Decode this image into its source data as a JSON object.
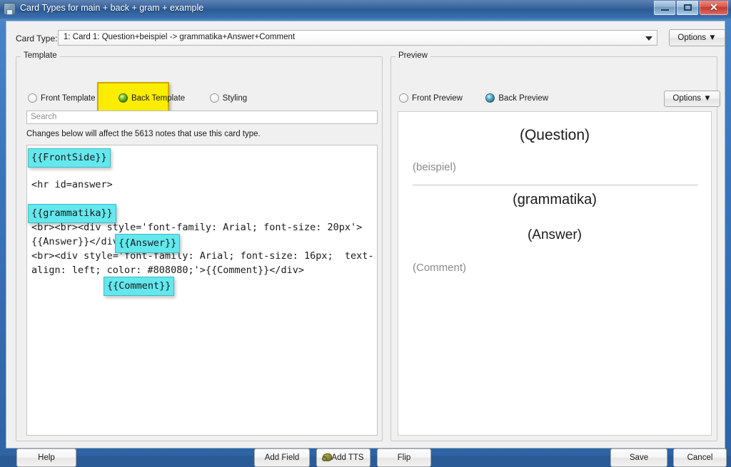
{
  "window": {
    "title": "Card Types for main + back + gram + example",
    "icon": "card-types-icon",
    "controls": {
      "minimize": "minimize-icon",
      "maximize": "maximize-icon",
      "close": "close-icon"
    }
  },
  "cardtype": {
    "label": "Card Type:",
    "value": "1: Card 1: Question+beispiel -> grammatika+Answer+Comment",
    "options_label": "Options ▼"
  },
  "template": {
    "legend": "Template",
    "radios": [
      {
        "label": "Front Template",
        "selected": false
      },
      {
        "label": "Back Template",
        "selected": true
      },
      {
        "label": "Styling",
        "selected": false
      }
    ],
    "search_placeholder": "Search",
    "search_value": "",
    "note": "Changes below will affect the 5613 notes that use this card type.",
    "note_count": "5613",
    "code": "{{FrontSide}}\n\n<hr id=answer>\n\n{{grammatika}}\n<br><br><div style='font-family: Arial; font-size: 20px'>{{Answer}}</div>\n<br><div style='font-family: Arial; font-size: 16px;  text-align: left; color: #808080;'>{{Comment}}</div>",
    "annotations": [
      {
        "text": "{{FrontSide}}",
        "color": "#63e8ee"
      },
      {
        "text": "{{grammatika}}",
        "color": "#63e8ee"
      },
      {
        "text": "{{Answer}}",
        "color": "#63e8ee"
      },
      {
        "text": "{{Comment}}",
        "color": "#63e8ee"
      }
    ],
    "highlight_color": "#fbed00"
  },
  "preview": {
    "legend": "Preview",
    "radios": [
      {
        "label": "Front Preview",
        "selected": false
      },
      {
        "label": "Back Preview",
        "selected": true
      }
    ],
    "options_label": "Options ▼",
    "card": {
      "question": "(Question)",
      "beispiel": "(beispiel)",
      "grammatika": "(grammatika)",
      "answer": "(Answer)",
      "comment": "(Comment)"
    }
  },
  "buttons": {
    "help": "Help",
    "add_field": "Add Field",
    "add_tts": "Add TTS",
    "add_tts_icon": "speaker-icon",
    "flip": "Flip",
    "save": "Save",
    "cancel": "Cancel"
  }
}
